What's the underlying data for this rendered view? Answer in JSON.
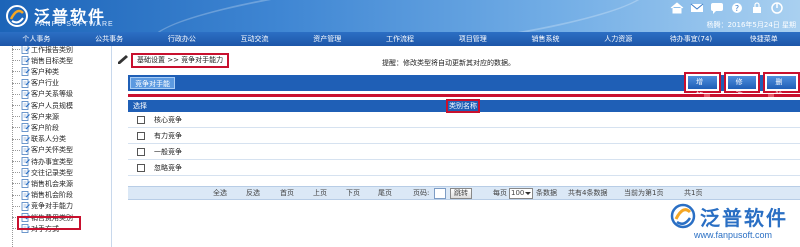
{
  "header": {
    "logo_cn": "泛普软件",
    "logo_en": "FANPU SOFTWARE",
    "user_line": "杨腾：2016年5月24日 星期"
  },
  "nav": [
    "个人事务",
    "公共事务",
    "行政办公",
    "互动交流",
    "资产管理",
    "工作流程",
    "项目管理",
    "销售系统",
    "人力资源",
    "待办事宜(74)",
    "快捷菜单"
  ],
  "sidebar": {
    "items": [
      "工作报告类别",
      "销售目标类型",
      "客户种类",
      "客户行业",
      "客户关系等级",
      "客户人员规模",
      "客户来源",
      "客户阶段",
      "联系人分类",
      "客户关怀类型",
      "待办事宜类型",
      "交往记录类型",
      "销售机会来源",
      "销售机会阶段",
      "竞争对手能力",
      "销售费用类别",
      "对手方式"
    ],
    "active_index": 14
  },
  "breadcrumb": "基础设置 >> 竞争对手能力",
  "tip": "提醒：修改类型将自动更新其对应的数据。",
  "toolbar": {
    "tab": "竞争对手能",
    "buttons": {
      "add": "增加",
      "edit": "修改",
      "delete": "删除"
    }
  },
  "table": {
    "headers": {
      "select": "选择",
      "name": "类别名称"
    },
    "rows": [
      "核心竞争",
      "有力竞争",
      "一般竞争",
      "忽略竞争"
    ]
  },
  "pager": {
    "select_all": "全选",
    "invert": "反选",
    "first": "首页",
    "prev": "上页",
    "next": "下页",
    "last": "尾页",
    "page_label": "页码:",
    "jump": "跳转",
    "per_page_label": "每页",
    "per_page_value": "100",
    "per_page_unit": "条数据",
    "total": "共有4条数据",
    "current": "当前为第1页",
    "pages": "共1页"
  },
  "watermark": {
    "cn": "泛普软件",
    "url": "www.fanpusoft.com"
  },
  "colors": {
    "brand_blue": "#1f5fb6",
    "highlight_red": "#c8102e"
  }
}
